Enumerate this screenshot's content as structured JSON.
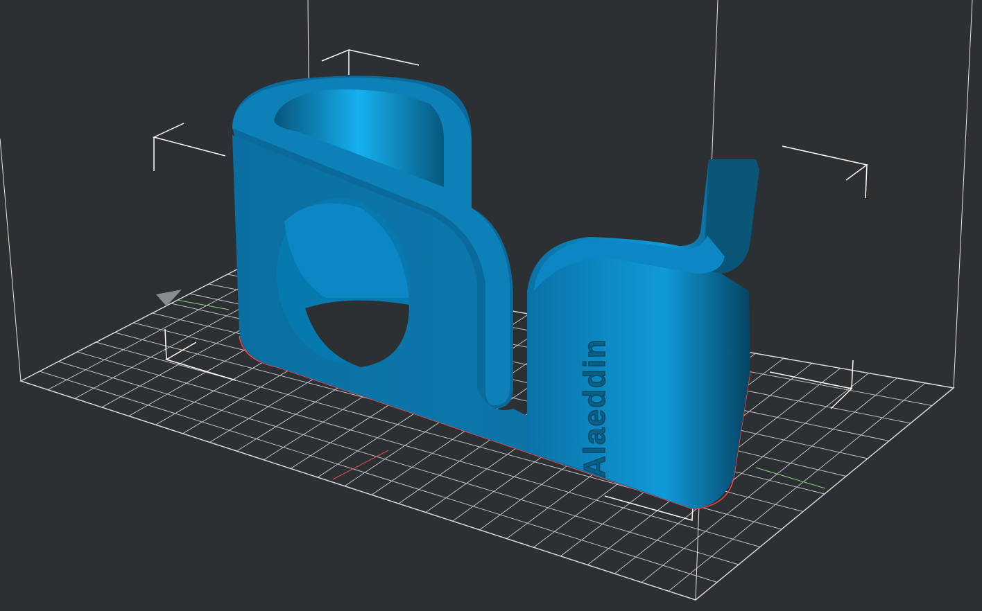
{
  "viewer": {
    "background_color": "#2d3033",
    "model_color": "#1a8fc9",
    "outline_color": "#ff4040",
    "grid_color": "#cfd2d4",
    "axis_x_color": "#e05050",
    "axis_y_color": "#8fd080"
  },
  "model": {
    "embossed_label": "Alaeddin"
  }
}
